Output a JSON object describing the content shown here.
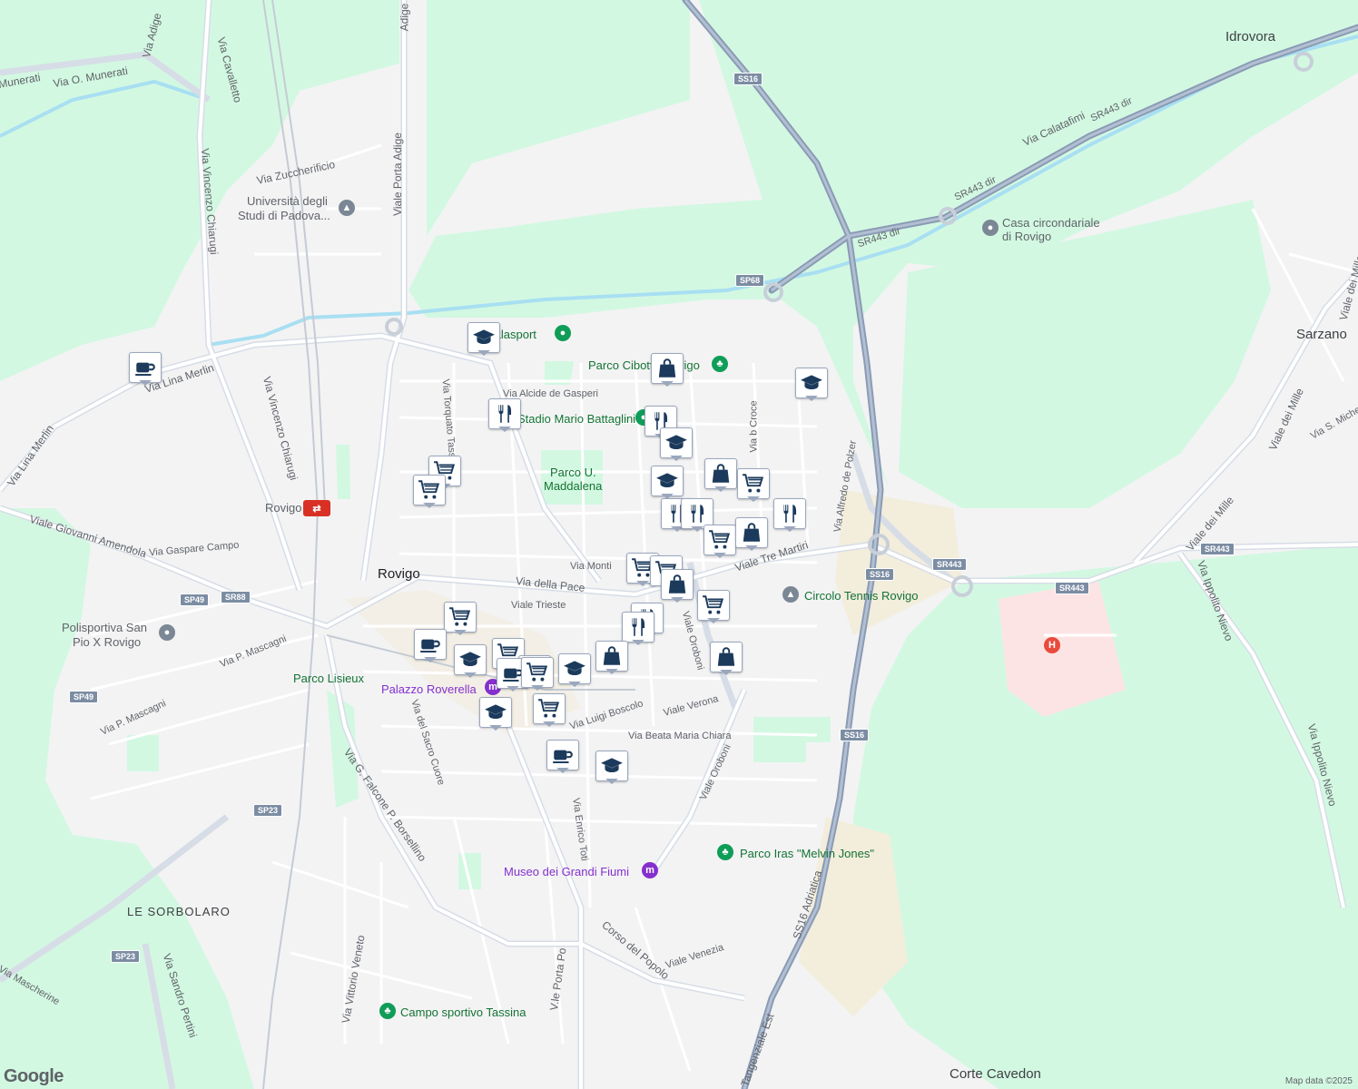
{
  "map": {
    "attribution": "Map data ©2025",
    "logo": "Google",
    "colors": {
      "land": "#f3f3f4",
      "green": "#d3f8e2",
      "road": "#ffffff",
      "highway": "#8a9bb5",
      "water": "#a8dff2",
      "hospital": "#fde4e4",
      "sand": "#f3eddc",
      "pin_icon": "#1b3a5c"
    }
  },
  "labels": [
    {
      "text": "Idrovora",
      "cls": "area"
    },
    {
      "text": "Sarzano",
      "cls": "area"
    },
    {
      "text": "Rovigo",
      "cls": "town"
    },
    {
      "text": "LE SORBOLARO",
      "cls": "area"
    },
    {
      "text": "Corte Cavedon",
      "cls": "area"
    },
    {
      "text": "Università degli",
      "cls": "sport"
    },
    {
      "text": "Studi di Padova...",
      "cls": "sport"
    },
    {
      "text": "Casa circondariale",
      "cls": "sport"
    },
    {
      "text": "di Rovigo",
      "cls": "sport"
    },
    {
      "text": "Polisportiva San",
      "cls": "sport"
    },
    {
      "text": "Pio X Rovigo",
      "cls": "sport"
    },
    {
      "text": "Parco Lisieux",
      "cls": "park"
    },
    {
      "text": "Palazzo Roverella",
      "cls": "museum"
    },
    {
      "text": "Parco U.",
      "cls": "park"
    },
    {
      "text": "Maddalena",
      "cls": "park"
    },
    {
      "text": "Parco Cibotto Rovigo",
      "cls": "park"
    },
    {
      "text": "Stadio Mario Battaglini",
      "cls": "park"
    },
    {
      "text": "Palasport",
      "cls": "park"
    },
    {
      "text": "Circolo Tennis Rovigo",
      "cls": "park"
    },
    {
      "text": "Parco Iras \"Melvin Jones\"",
      "cls": "park"
    },
    {
      "text": "Museo dei Grandi Fiumi",
      "cls": "museum"
    },
    {
      "text": "Campo sportivo Tassina",
      "cls": "park"
    },
    {
      "text": "Rovigo",
      "cls": "sport"
    },
    {
      "text": "Via Adige",
      "cls": ""
    },
    {
      "text": "Via O. Munerati",
      "cls": ""
    },
    {
      "text": "Munerati",
      "cls": ""
    },
    {
      "text": "Via Cavalletto",
      "cls": ""
    },
    {
      "text": "Viale Porta Adige",
      "cls": ""
    },
    {
      "text": "Adige",
      "cls": ""
    },
    {
      "text": "Via Zuccherificio",
      "cls": ""
    },
    {
      "text": "Via Vincenzo Chiarugi",
      "cls": ""
    },
    {
      "text": "Via Lina Merlin",
      "cls": ""
    },
    {
      "text": "Via Torquato Tasso",
      "cls": ""
    },
    {
      "text": "Via Alcide de Gasperi",
      "cls": ""
    },
    {
      "text": "Via Gaspare Campo",
      "cls": ""
    },
    {
      "text": "Viale Giovanni Amendola",
      "cls": ""
    },
    {
      "text": "Via Monti",
      "cls": ""
    },
    {
      "text": "Via della Pace",
      "cls": ""
    },
    {
      "text": "Viale Trieste",
      "cls": ""
    },
    {
      "text": "Viale Tre Martiri",
      "cls": ""
    },
    {
      "text": "Via b Croce",
      "cls": ""
    },
    {
      "text": "Via Alfredo de Polzer",
      "cls": ""
    },
    {
      "text": "Via P. Mascagni",
      "cls": ""
    },
    {
      "text": "Via del Sacro Cuore",
      "cls": ""
    },
    {
      "text": "Via Luigi Boscolo",
      "cls": ""
    },
    {
      "text": "Viale Verona",
      "cls": ""
    },
    {
      "text": "Via Beata Maria Chiara",
      "cls": ""
    },
    {
      "text": "Viale Oroboni",
      "cls": ""
    },
    {
      "text": "Via G. Falcone P. Borsellino",
      "cls": ""
    },
    {
      "text": "Via Enrico Toti",
      "cls": ""
    },
    {
      "text": "Corso del Popolo",
      "cls": ""
    },
    {
      "text": "Viale Venezia",
      "cls": ""
    },
    {
      "text": "V.le Porta Po",
      "cls": ""
    },
    {
      "text": "Via Vittorio Veneto",
      "cls": ""
    },
    {
      "text": "Via Sandro Pertini",
      "cls": ""
    },
    {
      "text": "Via Mascherine",
      "cls": ""
    },
    {
      "text": "Via Calatafimi",
      "cls": ""
    },
    {
      "text": "SR443 dir",
      "cls": ""
    },
    {
      "text": "Viale dei Mille",
      "cls": ""
    },
    {
      "text": "Via Ippolito Nievo",
      "cls": ""
    },
    {
      "text": "Via S. Michele",
      "cls": ""
    },
    {
      "text": "Tangenziale Est",
      "cls": ""
    },
    {
      "text": "SS16 Adriatica",
      "cls": ""
    },
    {
      "text": "SS16",
      "cls": "shield"
    },
    {
      "text": "SP68",
      "cls": "shield"
    },
    {
      "text": "SS16",
      "cls": "shield"
    },
    {
      "text": "SR443",
      "cls": "shield"
    },
    {
      "text": "SR443",
      "cls": "shield"
    },
    {
      "text": "SR443",
      "cls": "shield"
    },
    {
      "text": "SP49",
      "cls": "shield"
    },
    {
      "text": "SR88",
      "cls": "shield"
    },
    {
      "text": "SP49",
      "cls": "shield"
    },
    {
      "text": "SS16",
      "cls": "shield"
    },
    {
      "text": "SP23",
      "cls": "shield"
    },
    {
      "text": "SP23",
      "cls": "shield"
    }
  ],
  "pins": [
    {
      "type": "cafe"
    },
    {
      "type": "school"
    },
    {
      "type": "bag"
    },
    {
      "type": "school"
    },
    {
      "type": "restaurant"
    },
    {
      "type": "restaurant"
    },
    {
      "type": "school"
    },
    {
      "type": "cart"
    },
    {
      "type": "cart"
    },
    {
      "type": "school"
    },
    {
      "type": "bag"
    },
    {
      "type": "cart"
    },
    {
      "type": "restaurant"
    },
    {
      "type": "restaurant"
    },
    {
      "type": "restaurant"
    },
    {
      "type": "cart"
    },
    {
      "type": "bag"
    },
    {
      "type": "cart"
    },
    {
      "type": "cart"
    },
    {
      "type": "bag"
    },
    {
      "type": "cart"
    },
    {
      "type": "restaurant"
    },
    {
      "type": "restaurant"
    },
    {
      "type": "bag"
    },
    {
      "type": "cart"
    },
    {
      "type": "cafe"
    },
    {
      "type": "school"
    },
    {
      "type": "cart"
    },
    {
      "type": "cart"
    },
    {
      "type": "cafe"
    },
    {
      "type": "cart"
    },
    {
      "type": "school"
    },
    {
      "type": "bag"
    },
    {
      "type": "school"
    },
    {
      "type": "cart"
    },
    {
      "type": "cafe"
    },
    {
      "type": "school"
    }
  ]
}
